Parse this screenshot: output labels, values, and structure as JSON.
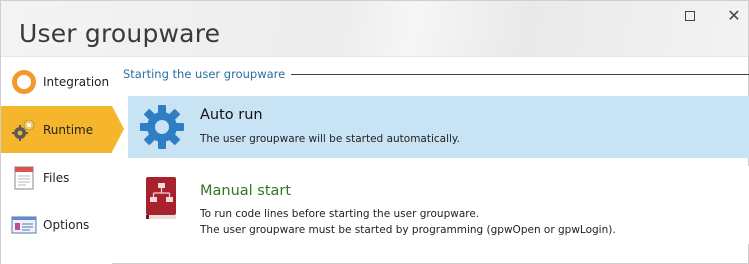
{
  "window": {
    "title": "User groupware",
    "maximize_icon": "maximize-icon",
    "close_glyph": "✕"
  },
  "sidebar": {
    "items": [
      {
        "label": "Integration",
        "icon": "integration-ring-icon",
        "active": false
      },
      {
        "label": "Runtime",
        "icon": "runtime-gears-icon",
        "active": true
      },
      {
        "label": "Files",
        "icon": "files-icon",
        "active": false
      },
      {
        "label": "Options",
        "icon": "options-icon",
        "active": false
      }
    ],
    "active_color": "#f5b52d"
  },
  "main": {
    "section_title": "Starting the user groupware",
    "options": [
      {
        "title": "Auto run",
        "icon": "gear-icon",
        "description": "The user groupware will be started automatically.",
        "selected": true
      },
      {
        "title": "Manual start",
        "icon": "manual-book-icon",
        "description_lines": [
          "To run code lines before starting the user groupware.",
          "The user groupware must be started by programming (gpwOpen or gpwLogin)."
        ],
        "selected": false
      }
    ]
  },
  "colors": {
    "selected_bg": "#c8e3f3",
    "section_title": "#2b6f9e",
    "manual_title": "#2f7a1f"
  }
}
